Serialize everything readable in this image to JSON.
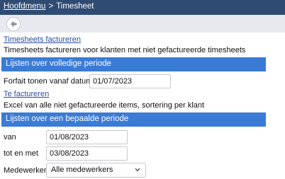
{
  "breadcrumb": {
    "home": "Hoofdmenu",
    "separator": ">",
    "current": "Timesheet"
  },
  "toolbar": {
    "back_icon": "arrow-left-icon"
  },
  "section1": {
    "link": "Timesheets factureren",
    "description": "Timesheets factureren voor klanten met niet gefactureerde timesheets"
  },
  "band1": {
    "title": "Lijsten over volledige periode"
  },
  "forfait": {
    "label": "Forfait tonen vanaf datum",
    "value": "01/07/2023"
  },
  "section2": {
    "link": "Te factureren",
    "description": "Excel van alle niet gefactureerde items, sortering per klant"
  },
  "band2": {
    "title": "Lijsten over een bepaalde periode"
  },
  "period": {
    "from_label": "van",
    "from_value": "01/08/2023",
    "to_label": "tot en met",
    "to_value": "03/08/2023"
  },
  "employee": {
    "label": "Medewerker",
    "selected": "Alle medewerkers"
  },
  "colors": {
    "topbar": "#2f4b73",
    "band": "#3a7bd5",
    "link": "#2d4da3",
    "toolbar": "#e7e9ee"
  }
}
